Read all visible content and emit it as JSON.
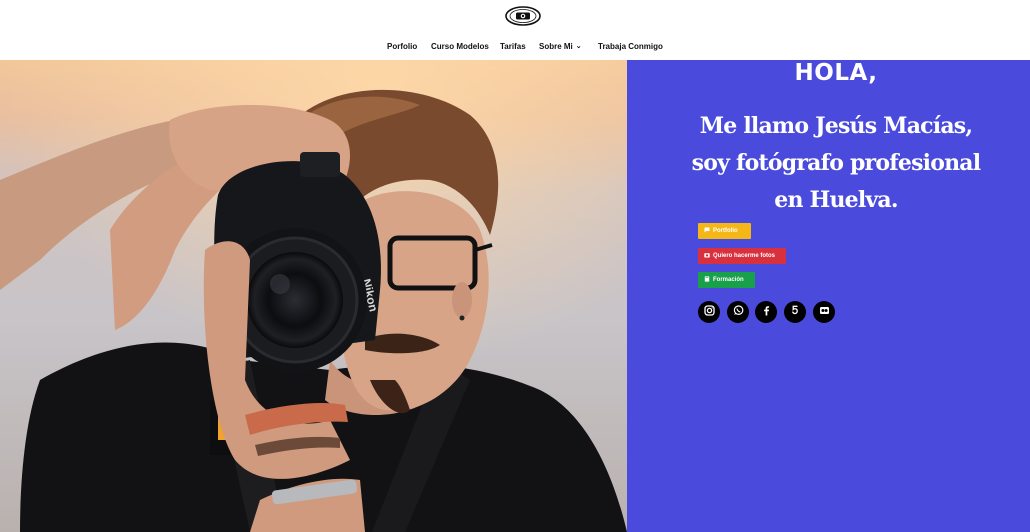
{
  "header": {
    "logo_icon": "photography-badge-logo",
    "nav": [
      {
        "label": "Porfolio"
      },
      {
        "label": "Curso Modelos"
      },
      {
        "label": "Tarifas"
      },
      {
        "label": "Sobre Mi"
      },
      {
        "label": "Trabaja Conmigo"
      }
    ]
  },
  "hero": {
    "greeting": "HOLA,",
    "headline_lines": [
      "Me llamo Jesús Macías,",
      "soy fotógrafo profesional",
      "en Huelva."
    ],
    "panel_color": "#4a4bdc"
  },
  "buttons": [
    {
      "label": "Portfolio",
      "icon": "chat-bubble-icon",
      "color": "#f5b716"
    },
    {
      "label": "Quiero hacerme fotos",
      "icon": "camera-icon",
      "color": "#d9303e"
    },
    {
      "label": "Formación",
      "icon": "book-icon",
      "color": "#18a04a"
    }
  ],
  "social": [
    {
      "icon": "instagram-icon"
    },
    {
      "icon": "whatsapp-icon"
    },
    {
      "icon": "facebook-icon"
    },
    {
      "icon": "500px-icon"
    },
    {
      "icon": "flickr-icon"
    }
  ]
}
